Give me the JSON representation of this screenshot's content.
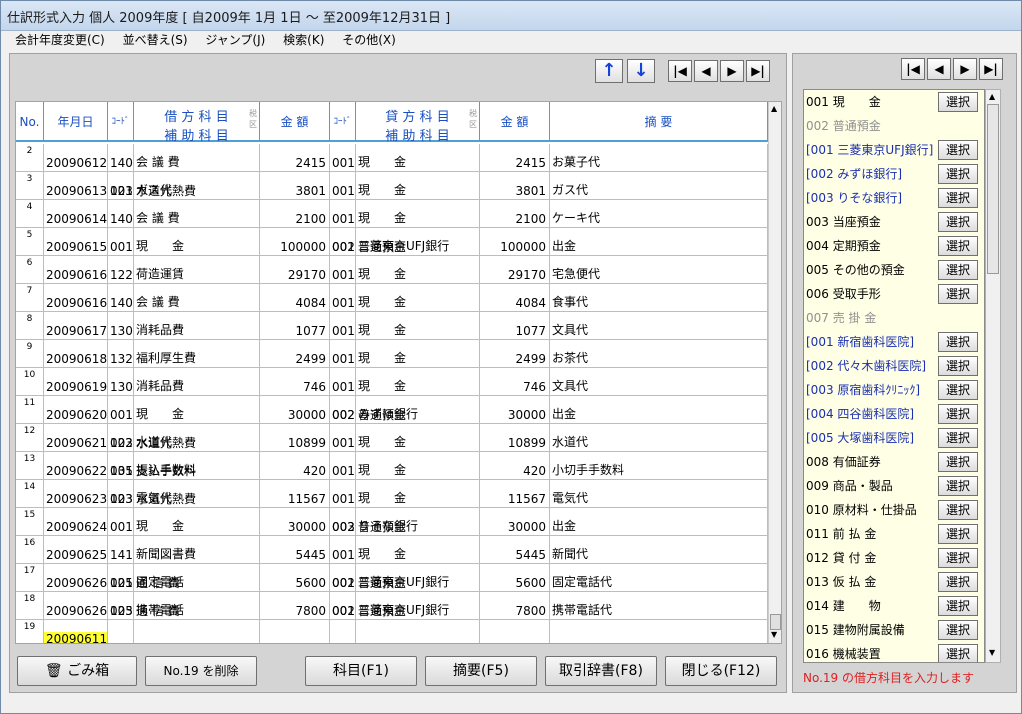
{
  "window": {
    "title": "仕訳形式入力  個人 2009年度 [ 自2009年 1月 1日 〜 至2009年12月31日 ]"
  },
  "menu": [
    "会計年度変更(C)",
    "並べ替え(S)",
    "ジャンプ(J)",
    "検索(K)",
    "その他(X)"
  ],
  "nav": {
    "first": "|◀",
    "prev": "◀",
    "next": "▶",
    "last": "▶|",
    "up": "↑",
    "down": "↓"
  },
  "grid": {
    "headers": {
      "no": "No.",
      "date": "年月日",
      "code": "ｺｰﾄﾞ",
      "debit1": "借 方 科 目",
      "debit2": "補 助 科 目",
      "tax": "税区",
      "amount": "金 額",
      "code2": "ｺｰﾄﾞ",
      "credit1": "貸 方 科 目",
      "credit2": "補 助 科 目",
      "tax2": "税区",
      "amount2": "金 額",
      "memo": "摘          要"
    },
    "rows": [
      {
        "no": "2",
        "date": "20090612",
        "dc": "140",
        "dn": "会 議 費",
        "dsc": "",
        "dsn": "",
        "amt": "2415",
        "cc": "001",
        "cn": "現　　金",
        "csc": "",
        "csn": "",
        "amt2": "2415",
        "memo": "お菓子代"
      },
      {
        "no": "3",
        "date": "20090613",
        "dc": "123",
        "dn": "水道光熱費",
        "dsc": "001",
        "dsn": "ガス代",
        "amt": "3801",
        "cc": "001",
        "cn": "現　　金",
        "csc": "",
        "csn": "",
        "amt2": "3801",
        "memo": "ガス代"
      },
      {
        "no": "4",
        "date": "20090614",
        "dc": "140",
        "dn": "会 議 費",
        "dsc": "",
        "dsn": "",
        "amt": "2100",
        "cc": "001",
        "cn": "現　　金",
        "csc": "",
        "csn": "",
        "amt2": "2100",
        "memo": "ケーキ代"
      },
      {
        "no": "5",
        "date": "20090615",
        "dc": "001",
        "dn": "現　　金",
        "dsc": "",
        "dsn": "",
        "amt": "100000",
        "cc": "002",
        "cn": "普通預金",
        "csc": "001",
        "csn": "三菱東京UFJ銀行",
        "amt2": "100000",
        "memo": "出金"
      },
      {
        "no": "6",
        "date": "20090616",
        "dc": "122",
        "dn": "荷造運賃",
        "dsc": "",
        "dsn": "",
        "amt": "29170",
        "cc": "001",
        "cn": "現　　金",
        "csc": "",
        "csn": "",
        "amt2": "29170",
        "memo": "宅急便代"
      },
      {
        "no": "7",
        "date": "20090616",
        "dc": "140",
        "dn": "会 議 費",
        "dsc": "",
        "dsn": "",
        "amt": "4084",
        "cc": "001",
        "cn": "現　　金",
        "csc": "",
        "csn": "",
        "amt2": "4084",
        "memo": "食事代"
      },
      {
        "no": "8",
        "date": "20090617",
        "dc": "130",
        "dn": "消耗品費",
        "dsc": "",
        "dsn": "",
        "amt": "1077",
        "cc": "001",
        "cn": "現　　金",
        "csc": "",
        "csn": "",
        "amt2": "1077",
        "memo": "文具代"
      },
      {
        "no": "9",
        "date": "20090618",
        "dc": "132",
        "dn": "福利厚生費",
        "dsc": "",
        "dsn": "",
        "amt": "2499",
        "cc": "001",
        "cn": "現　　金",
        "csc": "",
        "csn": "",
        "amt2": "2499",
        "memo": "お茶代"
      },
      {
        "no": "10",
        "date": "20090619",
        "dc": "130",
        "dn": "消耗品費",
        "dsc": "",
        "dsn": "",
        "amt": "746",
        "cc": "001",
        "cn": "現　　金",
        "csc": "",
        "csn": "",
        "amt2": "746",
        "memo": "文具代"
      },
      {
        "no": "11",
        "date": "20090620",
        "dc": "001",
        "dn": "現　　金",
        "dsc": "",
        "dsn": "",
        "amt": "30000",
        "cc": "002",
        "cn": "普通預金",
        "csc": "002",
        "csn": "みずほ銀行",
        "amt2": "30000",
        "memo": "出金"
      },
      {
        "no": "12",
        "date": "20090621",
        "dc": "123",
        "dn": "水道光熱費",
        "dsc": "002",
        "dsn": "水道代",
        "amt": "10899",
        "cc": "001",
        "cn": "現　　金",
        "csc": "",
        "csn": "",
        "amt2": "10899",
        "memo": "水道代"
      },
      {
        "no": "13",
        "date": "20090622",
        "dc": "135",
        "dn": "支払手数料",
        "dsc": "001",
        "dsn": "振込手数料",
        "amt": "420",
        "cc": "001",
        "cn": "現　　金",
        "csc": "",
        "csn": "",
        "amt2": "420",
        "memo": "小切手手数料"
      },
      {
        "no": "14",
        "date": "20090623",
        "dc": "123",
        "dn": "水道光熱費",
        "dsc": "003",
        "dsn": "電気代",
        "amt": "11567",
        "cc": "001",
        "cn": "現　　金",
        "csc": "",
        "csn": "",
        "amt2": "11567",
        "memo": "電気代"
      },
      {
        "no": "15",
        "date": "20090624",
        "dc": "001",
        "dn": "現　　金",
        "dsc": "",
        "dsn": "",
        "amt": "30000",
        "cc": "002",
        "cn": "普通預金",
        "csc": "003",
        "csn": "りそな銀行",
        "amt2": "30000",
        "memo": "出金"
      },
      {
        "no": "16",
        "date": "20090625",
        "dc": "141",
        "dn": "新聞図書費",
        "dsc": "",
        "dsn": "",
        "amt": "5445",
        "cc": "001",
        "cn": "現　　金",
        "csc": "",
        "csn": "",
        "amt2": "5445",
        "memo": "新聞代"
      },
      {
        "no": "17",
        "date": "20090626",
        "dc": "125",
        "dn": "通 信 費",
        "dsc": "001",
        "dsn": "固定電話",
        "amt": "5600",
        "cc": "002",
        "cn": "普通預金",
        "csc": "001",
        "csn": "三菱東京UFJ銀行",
        "amt2": "5600",
        "memo": "固定電話代"
      },
      {
        "no": "18",
        "date": "20090626",
        "dc": "125",
        "dn": "通 信 費",
        "dsc": "003",
        "dsn": "携帯電話",
        "amt": "7800",
        "cc": "002",
        "cn": "普通預金",
        "csc": "001",
        "csn": "三菱東京UFJ銀行",
        "amt2": "7800",
        "memo": "携帯電話代"
      },
      {
        "no": "19",
        "date": "20090611",
        "dc": "",
        "dn": "",
        "dsc": "",
        "dsn": "",
        "amt": "",
        "cc": "",
        "cn": "",
        "csc": "",
        "csn": "",
        "amt2": "",
        "memo": ""
      }
    ]
  },
  "accounts": [
    {
      "label": "001 現　　金",
      "type": "normal",
      "select": "選択"
    },
    {
      "label": "002 普通預金",
      "type": "gray",
      "select": ""
    },
    {
      "label": "[001 三菱東京UFJ銀行]",
      "type": "sub",
      "select": "選択"
    },
    {
      "label": "[002 みずほ銀行]",
      "type": "sub",
      "select": "選択"
    },
    {
      "label": "[003 りそな銀行]",
      "type": "sub",
      "select": "選択"
    },
    {
      "label": "003 当座預金",
      "type": "normal",
      "select": "選択"
    },
    {
      "label": "004 定期預金",
      "type": "normal",
      "select": "選択"
    },
    {
      "label": "005 その他の預金",
      "type": "normal",
      "select": "選択"
    },
    {
      "label": "006 受取手形",
      "type": "normal",
      "select": "選択"
    },
    {
      "label": "007 売 掛 金",
      "type": "gray",
      "select": ""
    },
    {
      "label": "[001 新宿歯科医院]",
      "type": "sub",
      "select": "選択"
    },
    {
      "label": "[002 代々木歯科医院]",
      "type": "sub",
      "select": "選択"
    },
    {
      "label": "[003 原宿歯科ｸﾘﾆｯｸ]",
      "type": "sub",
      "select": "選択"
    },
    {
      "label": "[004 四谷歯科医院]",
      "type": "sub",
      "select": "選択"
    },
    {
      "label": "[005 大塚歯科医院]",
      "type": "sub",
      "select": "選択"
    },
    {
      "label": "008 有価証券",
      "type": "normal",
      "select": "選択"
    },
    {
      "label": "009 商品・製品",
      "type": "normal",
      "select": "選択"
    },
    {
      "label": "010 原材料・仕掛品",
      "type": "normal",
      "select": "選択"
    },
    {
      "label": "011 前 払 金",
      "type": "normal",
      "select": "選択"
    },
    {
      "label": "012 貸 付 金",
      "type": "normal",
      "select": "選択"
    },
    {
      "label": "013 仮 払 金",
      "type": "normal",
      "select": "選択"
    },
    {
      "label": "014 建　　物",
      "type": "normal",
      "select": "選択"
    },
    {
      "label": "015 建物附属設備",
      "type": "normal",
      "select": "選択"
    },
    {
      "label": "016 機械装置",
      "type": "normal",
      "select": "選択"
    }
  ],
  "buttons": {
    "trash": "ごみ箱",
    "delete": "No.19 を削除",
    "kamoku": "科目(F1)",
    "tekiyo": "摘要(F5)",
    "jisho": "取引辞書(F8)",
    "close": "閉じる(F12)"
  },
  "status": "No.19 の借方科目を入力します",
  "colors": {
    "header_blue": "#1a4fc0",
    "sub_blue": "#1a2fb0",
    "status_red": "#e02020",
    "highlight": "#ffff33"
  }
}
